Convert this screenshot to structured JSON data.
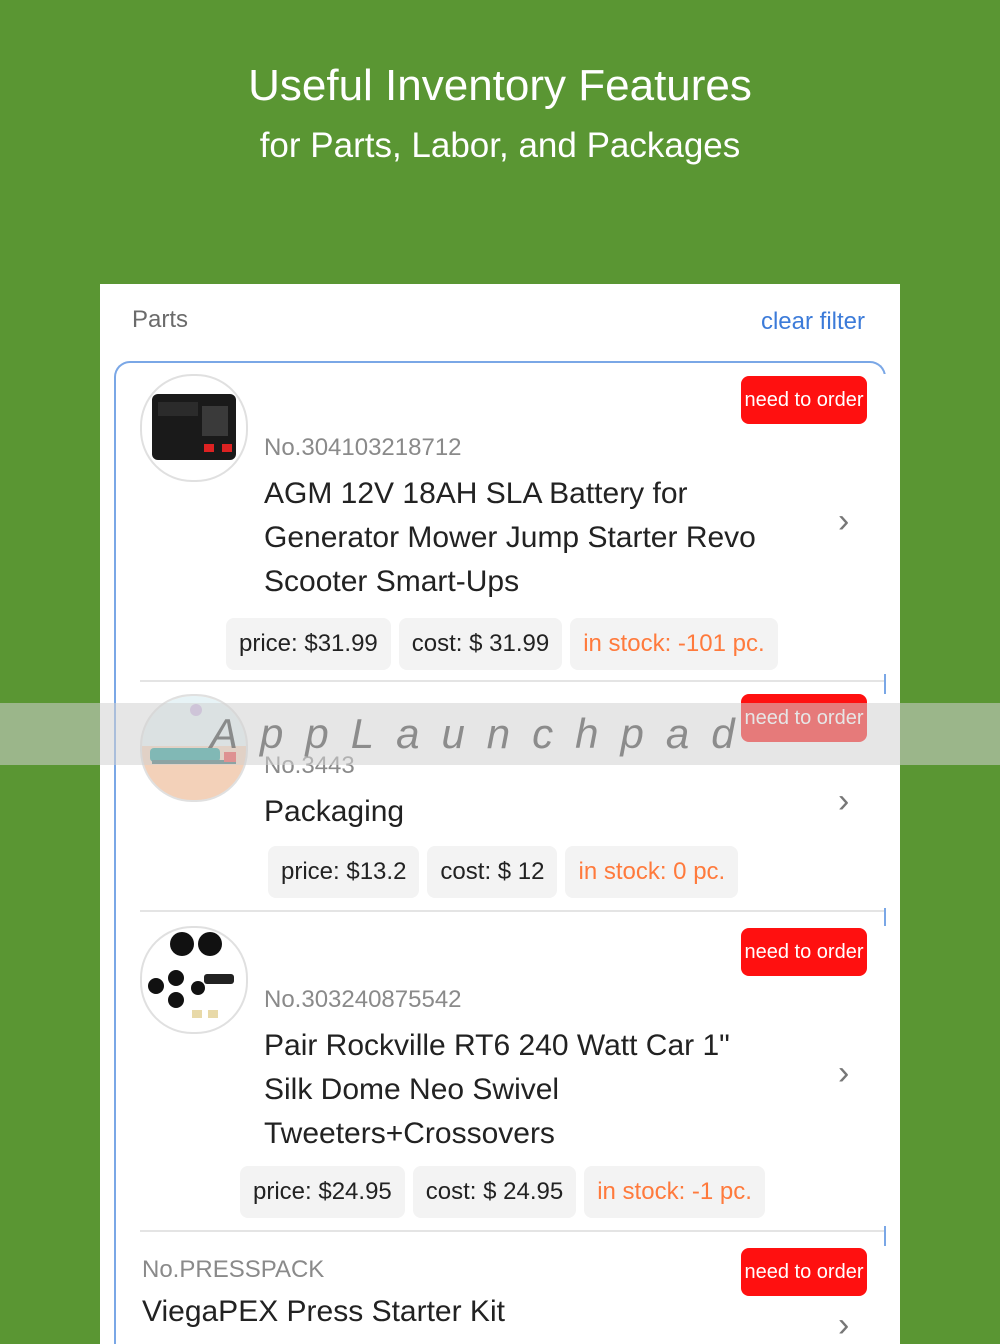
{
  "promo": {
    "title": "Useful Inventory Features",
    "subtitle": "for Parts, Labor, and Packages"
  },
  "header": {
    "title": "Parts",
    "clear_filter": "clear filter"
  },
  "items": [
    {
      "badge": "need to order",
      "sku": "No.304103218712",
      "name": "AGM 12V 18AH SLA Battery for Generator Mower Jump Starter Revo Scooter Smart-Ups",
      "price": "price: $31.99",
      "cost": "cost: $ 31.99",
      "stock": "in stock: -101 pc.",
      "thumb_icon": "battery-image"
    },
    {
      "badge": "need to order",
      "sku": "No.3443",
      "name": "Packaging",
      "price": "price: $13.2",
      "cost": "cost: $ 12",
      "stock": "in stock: 0 pc.",
      "thumb_icon": "packaging-image"
    },
    {
      "badge": "need to order",
      "sku": "No.303240875542",
      "name": "Pair Rockville RT6 240 Watt Car 1\" Silk Dome Neo Swivel Tweeters+Crossovers",
      "price": "price: $24.95",
      "cost": "cost: $ 24.95",
      "stock": "in stock: -1 pc.",
      "thumb_icon": "tweeters-image"
    },
    {
      "badge": "need to order",
      "sku": "No.PRESSPACK",
      "name": "ViegaPEX Press Starter Kit"
    }
  ],
  "watermark": "AppLaunchpad",
  "colors": {
    "background": "#5a9633",
    "badge": "#ff1010",
    "link": "#3c7bd9",
    "stock": "#ff7a3c"
  }
}
